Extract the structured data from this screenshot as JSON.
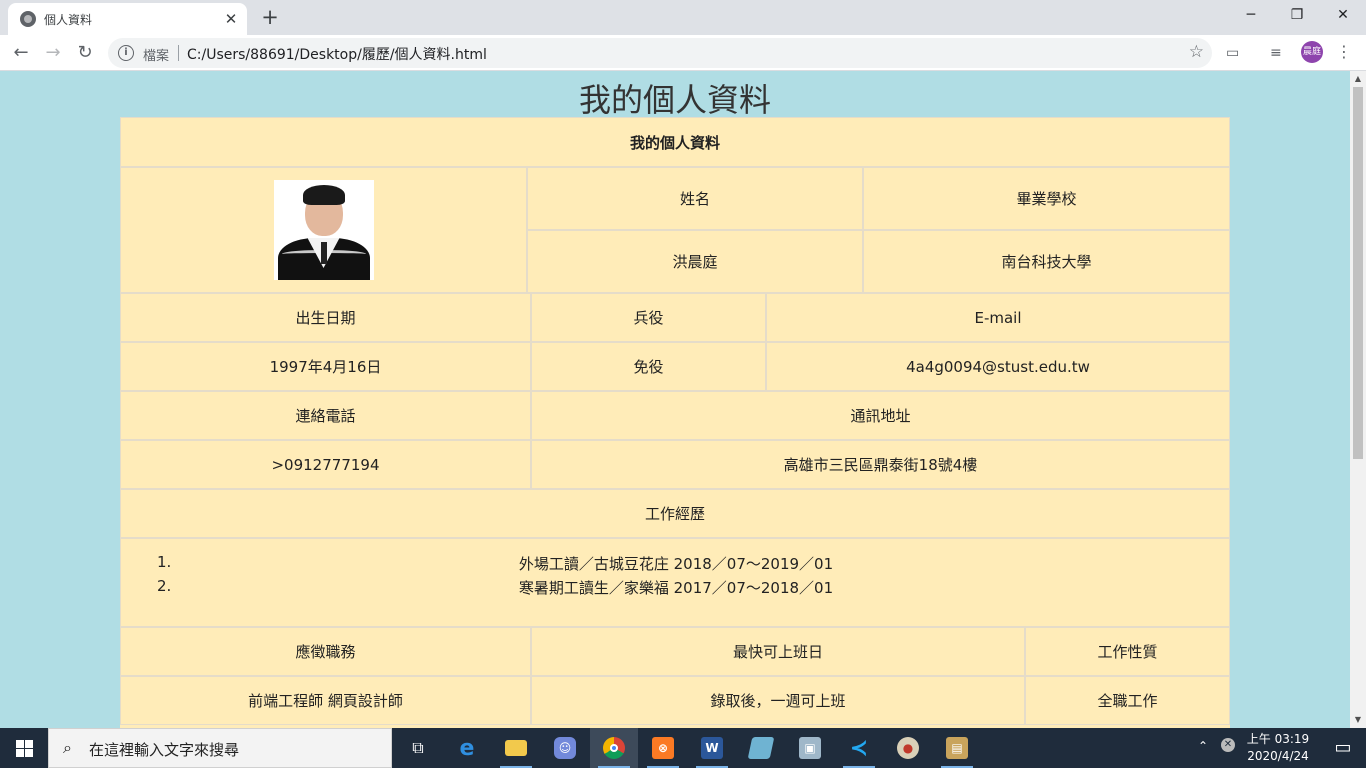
{
  "browser": {
    "tab_title": "個人資料",
    "new_tab": "+",
    "tab_close": "✕",
    "window_controls": {
      "minimize": "─",
      "maximize": "❐",
      "close": "✕"
    },
    "address_label": "檔案",
    "url": "C:/Users/88691/Desktop/履歷/個人資料.html",
    "profile_initials": "晨庭"
  },
  "page": {
    "heading": "我的個人資料",
    "table_caption": "我的個人資料",
    "photo_alt": "graduation photo",
    "name_label": "姓名",
    "name_value": "洪晨庭",
    "school_label": "畢業學校",
    "school_value": "南台科技大學",
    "birth_label": "出生日期",
    "birth_value": "1997年4月16日",
    "military_label": "兵役",
    "military_value": "免役",
    "email_label": "E-mail",
    "email_value": "4a4g0094@stust.edu.tw",
    "phone_label": "連絡電話",
    "phone_value": ">0912777194",
    "address_label": "通訊地址",
    "address_value": "高雄市三民區鼎泰街18號4樓",
    "experience_label": "工作經歷",
    "experience": [
      {
        "num": "1.",
        "text": "外場工讀／古城豆花庄 2018／07～2019／01"
      },
      {
        "num": "2.",
        "text": "寒暑期工讀生／家樂福 2017／07～2018／01"
      }
    ],
    "position_label": "應徵職務",
    "position_value": "前端工程師 網頁設計師",
    "start_label": "最快可上班日",
    "start_value": "錄取後，一週可上班",
    "jobtype_label": "工作性質",
    "jobtype_value": "全職工作"
  },
  "taskbar": {
    "search_placeholder": "在這裡輸入文字來搜尋",
    "clock_time": "上午 03:19",
    "clock_date": "2020/4/24",
    "apps": [
      "task-view",
      "edge",
      "file-explorer",
      "discord",
      "chrome",
      "xampp",
      "word",
      "notepad-plus",
      "photos",
      "vscode",
      "paint",
      "video-editor"
    ]
  }
}
